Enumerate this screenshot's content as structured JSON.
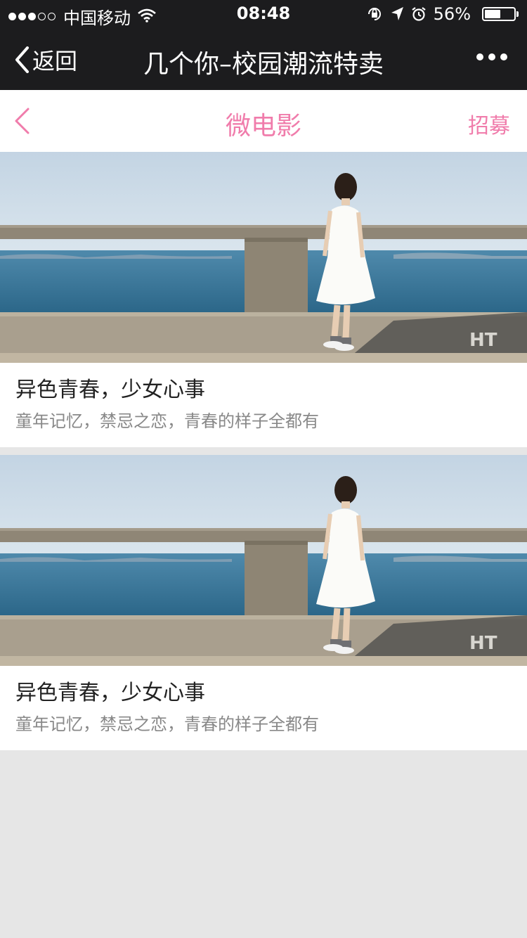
{
  "status_bar": {
    "carrier": "中国移动",
    "time": "08:48",
    "battery": "56%",
    "battery_level": 0.56
  },
  "wechat_nav": {
    "back_label": "返回",
    "title": "几个你–校园潮流特卖"
  },
  "page_header": {
    "title": "微电影",
    "recruit_label": "招募"
  },
  "cards": [
    {
      "title": "异色青春，少女心事",
      "subtitle": "童年记忆，禁忌之恋，青春的样子全都有"
    },
    {
      "title": "异色青春，少女心事",
      "subtitle": "童年记忆，禁忌之恋，青春的样子全都有"
    }
  ],
  "colors": {
    "accent": "#f07cab",
    "nav_bg": "#1c1c1e",
    "page_bg": "#e6e6e6"
  },
  "icons": [
    "wifi-icon",
    "orientation-lock-icon",
    "location-icon",
    "alarm-icon",
    "battery-icon",
    "back-chevron-icon",
    "more-icon",
    "pink-back-chevron-icon"
  ]
}
